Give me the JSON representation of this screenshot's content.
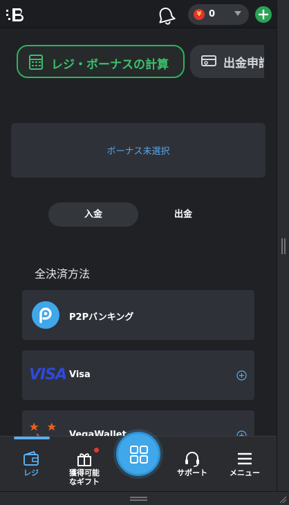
{
  "header": {
    "balance": "0",
    "currency_symbol": "¥"
  },
  "tabs": {
    "calculator_label": "レジ・ボーナスの計算",
    "withdrawal_label": "出金申請"
  },
  "bonus": {
    "status_text": "ボーナス未選択"
  },
  "segment": {
    "deposit_label": "入金",
    "withdraw_label": "出金"
  },
  "section": {
    "title": "全決済方法"
  },
  "methods": [
    {
      "name": "P2Pバンキング",
      "icon": "p2p-logo"
    },
    {
      "name": "Visa",
      "icon": "visa-logo",
      "logo_text": "VISA"
    },
    {
      "name": "VegaWallet",
      "icon": "vegawallet-logo"
    }
  ],
  "nav": {
    "items": [
      {
        "label": "レジ",
        "icon": "wallet-icon",
        "active": true
      },
      {
        "label": "獲得可能\nなギフト",
        "icon": "gift-icon"
      },
      {
        "label": "",
        "icon": "grid-icon"
      },
      {
        "label": "サポート",
        "icon": "headset-icon"
      },
      {
        "label": "メニュー",
        "icon": "menu-icon"
      }
    ]
  },
  "colors": {
    "background": "#1f2125",
    "card": "#2e3138",
    "accent_green": "#2fb45e",
    "accent_blue": "#3fa7ea",
    "link_blue": "#58a6e8"
  }
}
